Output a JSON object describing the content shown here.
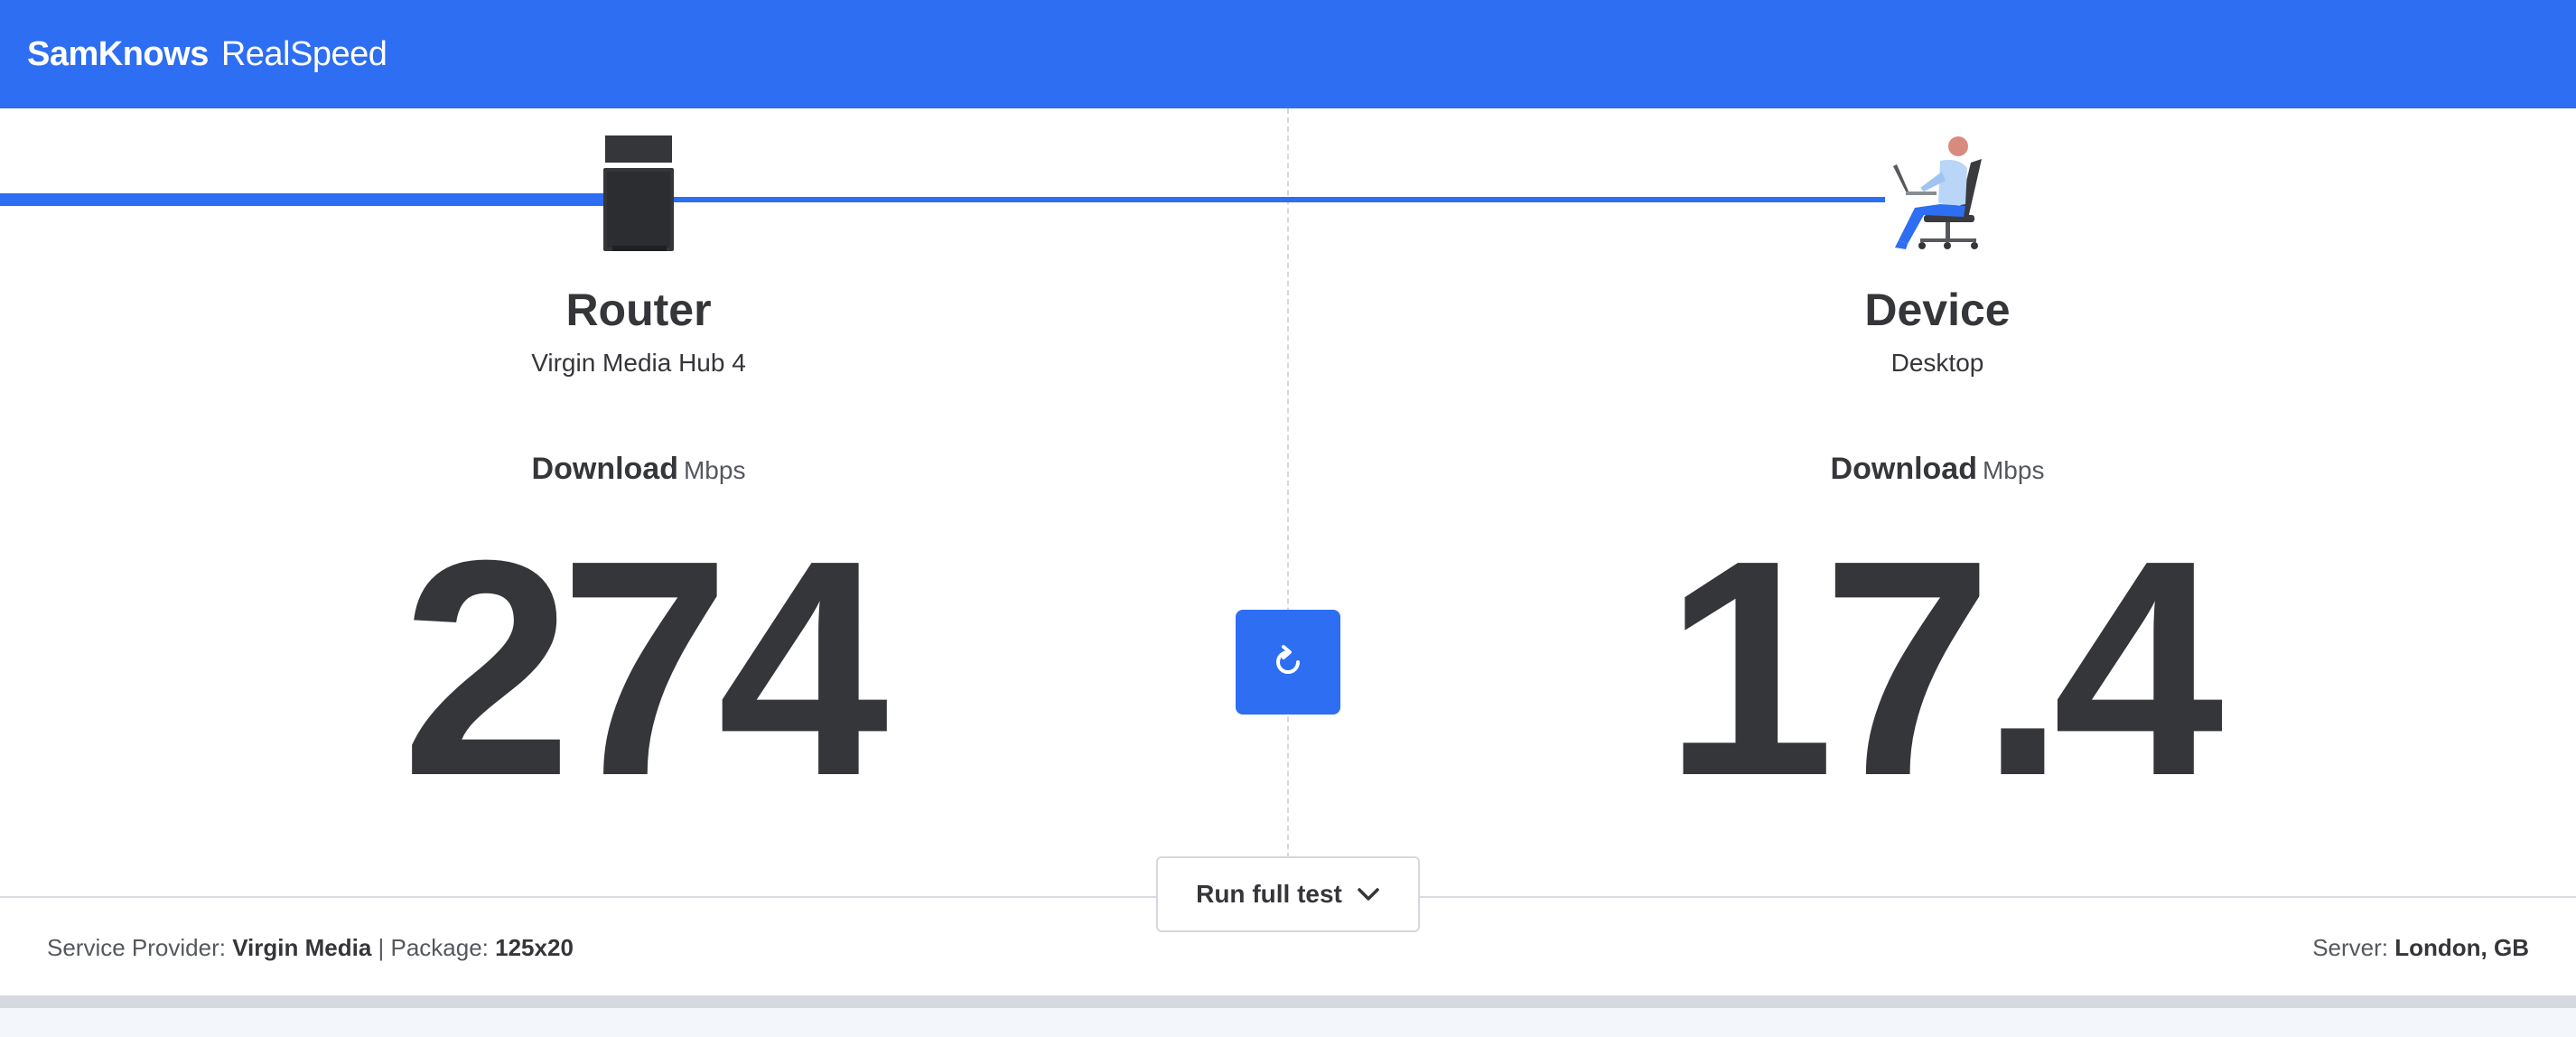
{
  "header": {
    "brand_bold": "SamKnows",
    "brand_light": "RealSpeed",
    "bg_color": "#2d6ef2"
  },
  "router": {
    "title": "Router",
    "subtitle": "Virgin Media Hub 4",
    "metric_name": "Download",
    "metric_unit": "Mbps",
    "value": "274",
    "icon": "router-icon"
  },
  "device": {
    "title": "Device",
    "subtitle": "Desktop",
    "metric_name": "Download",
    "metric_unit": "Mbps",
    "value": "17.4",
    "icon": "person-at-desktop-icon"
  },
  "actions": {
    "refresh_icon": "refresh-icon",
    "run_full_test_label": "Run full test",
    "run_full_test_icon": "chevron-down-icon"
  },
  "footer": {
    "provider_label": "Service Provider: ",
    "provider_value": "Virgin Media",
    "separator": " | ",
    "package_label": "Package: ",
    "package_value": "125x20",
    "server_label": "Server: ",
    "server_value": "London, GB"
  },
  "colors": {
    "accent": "#2d6ef2",
    "text": "#35363a"
  }
}
